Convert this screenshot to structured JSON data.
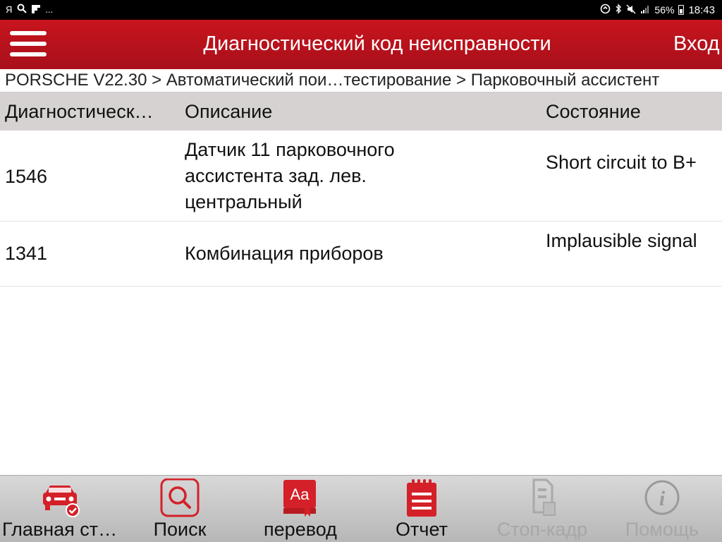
{
  "statusbar": {
    "left_icons": [
      "yandex-icon",
      "search-icon",
      "flipboard-icon",
      "more-icon"
    ],
    "left_text_1": "Я",
    "left_text_2": "...",
    "battery": "56%",
    "time": "18:43"
  },
  "header": {
    "title": "Диагностический код неисправности",
    "login": "Вход"
  },
  "breadcrumb": "PORSCHE V22.30 > Автоматический пои…тестирование > Парковочный ассистент",
  "table": {
    "headers": {
      "code": "Диагностическ…",
      "description": "Описание",
      "state": "Состояние"
    },
    "rows": [
      {
        "code": "1546",
        "description": "Датчик 11 парковочного ассистента зад. лев. центральный",
        "state": "Short circuit to B+"
      },
      {
        "code": "1341",
        "description": "Комбинация приборов",
        "state": "Implausible signal"
      }
    ]
  },
  "toolbar": {
    "items": [
      {
        "label": "Главная ст…",
        "icon": "car-home-icon",
        "enabled": true
      },
      {
        "label": "Поиск",
        "icon": "search-icon",
        "enabled": true
      },
      {
        "label": "перевод",
        "icon": "translate-icon",
        "enabled": true
      },
      {
        "label": "Отчет",
        "icon": "report-icon",
        "enabled": true
      },
      {
        "label": "Стоп-кадр",
        "icon": "freeze-frame-icon",
        "enabled": false
      },
      {
        "label": "Помощь",
        "icon": "help-icon",
        "enabled": false
      }
    ]
  },
  "colors": {
    "brand_red": "#c8141e",
    "header_bg": "#b8121c",
    "table_header_bg": "#d6d2d2",
    "toolbar_bg": "#c8c8c8",
    "disabled_text": "#a7a7a7"
  }
}
